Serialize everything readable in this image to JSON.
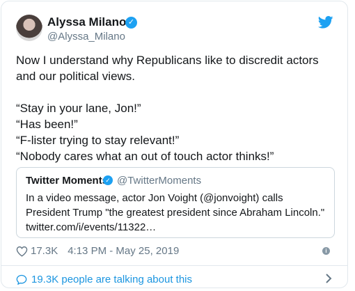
{
  "author": {
    "name": "Alyssa Milano",
    "handle": "@Alyssa_Milano"
  },
  "tweet": {
    "text": "Now I understand why Republicans like to discredit actors and our political views.\n\n“Stay in your lane, Jon!”\n“Has been!”\n“F-lister trying to stay relevant!”\n“Nobody cares what an out of touch actor thinks!”"
  },
  "quoted": {
    "name": "Twitter Moments",
    "handle": "@TwitterMoments",
    "text": "In a video message, actor Jon Voight (@jonvoight) calls President Trump \"the greatest president since Abraham Lincoln.\" twitter.com/i/events/11322…"
  },
  "meta": {
    "likes": "17.3K",
    "timestamp": "4:13 PM - May 25, 2019"
  },
  "footer": {
    "talking": "19.3K people are talking about this"
  },
  "icons": {
    "verified": "verified-badge-icon",
    "bird": "twitter-bird-icon",
    "heart": "heart-icon",
    "info": "info-icon",
    "talk": "speech-bubble-icon",
    "chevron": "chevron-right-icon"
  },
  "colors": {
    "accent": "#1da1f2",
    "link": "#1b95e0",
    "muted": "#657786",
    "border": "#e1e8ed"
  }
}
